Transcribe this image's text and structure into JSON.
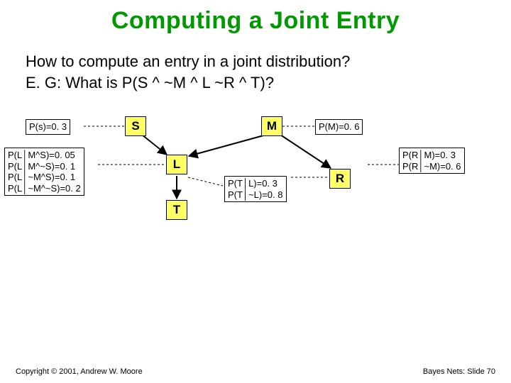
{
  "title": "Computing a Joint Entry",
  "question_line1": "How to compute an entry in a joint distribution?",
  "question_line2": "E. G: What is P(S ^ ~M ^ L ~R ^ T)?",
  "nodes": {
    "S": "S",
    "M": "M",
    "L": "L",
    "T": "T",
    "R": "R"
  },
  "cpt_S": "P(s)=0. 3",
  "cpt_M": "P(M)=0. 6",
  "cpt_L": {
    "r1": "P(L│M^S)=0. 05",
    "r2": "P(L│M^~S)=0. 1",
    "r3": "P(L│~M^S)=0. 1",
    "r4": "P(L│~M^~S)=0. 2"
  },
  "cpt_T": {
    "r1": "P(T│L)=0. 3",
    "r2": "P(T│~L)=0. 8"
  },
  "cpt_R": {
    "r1": "P(R│M)=0. 3",
    "r2": "P(R│~M)=0. 6"
  },
  "footer_left": "Copyright © 2001, Andrew W. Moore",
  "footer_right": "Bayes Nets: Slide 70"
}
